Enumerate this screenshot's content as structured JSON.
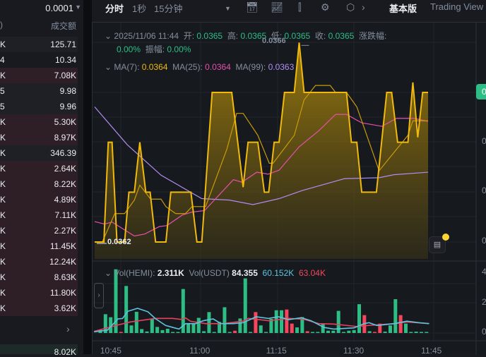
{
  "left_panel": {
    "tick_size": "0.0001",
    "col_left": ")",
    "col_right": "成交额",
    "rows": [
      {
        "l": "K",
        "r": "125.71",
        "t": "dark"
      },
      {
        "l": "4",
        "r": "10.34",
        "t": "none"
      },
      {
        "l": "K",
        "r": "7.08K",
        "t": "red"
      },
      {
        "l": "5",
        "r": "9.98",
        "t": "dark"
      },
      {
        "l": "5",
        "r": "9.96",
        "t": "dark"
      },
      {
        "l": "K",
        "r": "5.30K",
        "t": "red"
      },
      {
        "l": "K",
        "r": "8.97K",
        "t": "red"
      },
      {
        "l": "K",
        "r": "346.39",
        "t": "dark"
      },
      {
        "l": "K",
        "r": "2.64K",
        "t": "red"
      },
      {
        "l": "K",
        "r": "8.22K",
        "t": "red"
      },
      {
        "l": "K",
        "r": "4.89K",
        "t": "red"
      },
      {
        "l": "K",
        "r": "7.11K",
        "t": "red"
      },
      {
        "l": "K",
        "r": "2.27K",
        "t": "red"
      },
      {
        "l": "K",
        "r": "11.45K",
        "t": "red"
      },
      {
        "l": "K",
        "r": "12.24K",
        "t": "red"
      },
      {
        "l": "K",
        "r": "8.63K",
        "t": "red"
      },
      {
        "l": "K",
        "r": "11.80K",
        "t": "red"
      },
      {
        "l": "K",
        "r": "3.62K",
        "t": "red"
      }
    ],
    "more": "›",
    "last_value": "8.02K"
  },
  "toolbar": {
    "tab_time": "分时",
    "tab_1s": "1秒",
    "tab_15m": "15分钟",
    "basic": "基本版",
    "tradingview": "Trading View"
  },
  "legend": {
    "date": "2025/11/06 11:44",
    "open_l": "开:",
    "open": "0.0365",
    "high_l": "高:",
    "high": "0.0365",
    "low_l": "低:",
    "low": "0.0365",
    "close_l": "收:",
    "close": "0.0365",
    "chg_l": "涨跌幅:",
    "chg": "0.00%",
    "amp_l": "振幅:",
    "amp": "0.00%",
    "ma7_l": "MA(7):",
    "ma7": "0.0364",
    "ma25_l": "MA(25):",
    "ma25": "0.0364",
    "ma99_l": "MA(99):",
    "ma99": "0.0363",
    "vol_l": "Vol(HEMI):",
    "vol": "2.311K",
    "volu_l": "Vol(USDT)",
    "volu": "84.355",
    "vma1": "60.152K",
    "vma2": "63.04K"
  },
  "marks": {
    "high_label": "0.0366",
    "low_label": "0.0362"
  },
  "price_axis": {
    "badge": "0",
    "labels": [
      "0",
      "0",
      "0"
    ]
  },
  "vol_axis": [
    "4",
    "2",
    "0"
  ],
  "colors": {
    "price": "#f0b90b",
    "ma7": "#c99a0b",
    "ma25": "#e84fae",
    "ma99": "#b18cf2",
    "up": "#2ebd85",
    "down": "#f6465d",
    "vma1": "#5cc6e0",
    "vma2": "#e8415c"
  },
  "chart_data": [
    {
      "type": "area",
      "title": "分时",
      "xunit": "minutes from chart start",
      "ylim": [
        0.0362,
        0.0365
      ],
      "price": [
        [
          0,
          0.0362
        ],
        [
          1.7,
          0.0362
        ],
        [
          2.5,
          0.0364
        ],
        [
          3.2,
          0.0364
        ],
        [
          4.1,
          0.0362
        ],
        [
          5.5,
          0.0362
        ],
        [
          6.3,
          0.0363
        ],
        [
          7.3,
          0.0363
        ],
        [
          8.3,
          0.0364
        ],
        [
          9.4,
          0.0363
        ],
        [
          10.2,
          0.0363
        ],
        [
          11.2,
          0.0362
        ],
        [
          13.1,
          0.0362
        ],
        [
          14,
          0.0363
        ],
        [
          17.7,
          0.0363
        ],
        [
          18.8,
          0.0362
        ],
        [
          19.7,
          0.0362
        ],
        [
          21.6,
          0.0365
        ],
        [
          25.2,
          0.0365
        ],
        [
          27.3,
          0.03631
        ],
        [
          28.2,
          0.0364
        ],
        [
          30,
          0.0364
        ],
        [
          31.2,
          0.0363
        ],
        [
          32,
          0.0363
        ],
        [
          33,
          0.0364
        ],
        [
          33.9,
          0.0364
        ],
        [
          34.9,
          0.0365
        ],
        [
          36.7,
          0.0365
        ],
        [
          37.6,
          0.0366
        ],
        [
          38.5,
          0.0365
        ],
        [
          46.3,
          0.0365
        ],
        [
          47.2,
          0.0364
        ],
        [
          48.2,
          0.0364
        ],
        [
          49.1,
          0.0363
        ],
        [
          51.8,
          0.0363
        ],
        [
          53.7,
          0.0365
        ],
        [
          54.6,
          0.0365
        ],
        [
          55.7,
          0.0364
        ],
        [
          57.6,
          0.0364
        ],
        [
          58.5,
          0.03652
        ],
        [
          59.4,
          0.03641
        ],
        [
          60.3,
          0.0365
        ],
        [
          61.3,
          0.0365
        ]
      ],
      "ma7": [
        [
          0,
          0.0362
        ],
        [
          1.4,
          0.0362
        ],
        [
          3.7,
          0.036257
        ],
        [
          5.5,
          0.036257
        ],
        [
          7.3,
          0.036284
        ],
        [
          8.3,
          0.036314
        ],
        [
          10.3,
          0.036286
        ],
        [
          12.2,
          0.036286
        ],
        [
          13.1,
          0.036271
        ],
        [
          14.9,
          0.036257
        ],
        [
          16.7,
          0.036257
        ],
        [
          17.9,
          0.036271
        ],
        [
          20.4,
          0.036271
        ],
        [
          24.3,
          0.036386
        ],
        [
          26.1,
          0.036458
        ],
        [
          27.3,
          0.036458
        ],
        [
          30,
          0.036414
        ],
        [
          32.1,
          0.036358
        ],
        [
          32.8,
          0.036358
        ],
        [
          36.7,
          0.036414
        ],
        [
          38.5,
          0.036485
        ],
        [
          40.6,
          0.036514
        ],
        [
          43.3,
          0.036514
        ],
        [
          44.3,
          0.0365
        ],
        [
          46.3,
          0.0365
        ],
        [
          48.2,
          0.036471
        ],
        [
          52.3,
          0.036343
        ],
        [
          57.6,
          0.036414
        ],
        [
          58.5,
          0.036443
        ],
        [
          61.3,
          0.036443
        ]
      ],
      "ma25": [
        [
          0,
          0.036241
        ],
        [
          1.8,
          0.036236
        ],
        [
          3.2,
          0.03624
        ],
        [
          7.3,
          0.036212
        ],
        [
          9.2,
          0.036216
        ],
        [
          11.9,
          0.036231
        ],
        [
          13.3,
          0.036233
        ],
        [
          16.1,
          0.036254
        ],
        [
          17.9,
          0.03626
        ],
        [
          20.2,
          0.036263
        ],
        [
          25.5,
          0.036325
        ],
        [
          27.1,
          0.03632
        ],
        [
          29.8,
          0.03634
        ],
        [
          31.9,
          0.036336
        ],
        [
          33.9,
          0.036344
        ],
        [
          37.6,
          0.036391
        ],
        [
          41.3,
          0.036424
        ],
        [
          44.3,
          0.036456
        ],
        [
          46.3,
          0.036456
        ],
        [
          49.1,
          0.036439
        ],
        [
          52.8,
          0.036432
        ],
        [
          55.5,
          0.036448
        ],
        [
          58.7,
          0.036448
        ],
        [
          61.3,
          0.036442
        ]
      ],
      "ma99": [
        [
          0,
          0.036471
        ],
        [
          6,
          0.036395
        ],
        [
          12.2,
          0.036334
        ],
        [
          19.7,
          0.036287
        ],
        [
          24.8,
          0.036284
        ],
        [
          29.1,
          0.036275
        ],
        [
          33.9,
          0.036287
        ],
        [
          38.1,
          0.036303
        ],
        [
          45.9,
          0.036327
        ],
        [
          52.3,
          0.036329
        ],
        [
          55,
          0.036335
        ],
        [
          61.3,
          0.03634
        ]
      ],
      "x_ticks": [
        {
          "label": "10:45",
          "t": 3.1
        },
        {
          "label": "11:00",
          "t": 19.5
        },
        {
          "label": "11:15",
          "t": 33.6
        },
        {
          "label": "11:30",
          "t": 47.8
        },
        {
          "label": "11:45",
          "t": 62.1
        }
      ]
    },
    {
      "type": "bar",
      "title": "Vol(HEMI)",
      "yunit": "K",
      "ylim": [
        0,
        4.2
      ],
      "values": [
        0.2,
        1.24,
        1.04,
        4.2,
        0.06,
        3.1,
        0.5,
        1.4,
        0.26,
        0.1,
        0.93,
        0.4,
        0.19,
        0.28,
        0.06,
        0.06,
        2.9,
        0.65,
        0.62,
        1.0,
        0.12,
        1.38,
        0.06,
        0.73,
        1.7,
        0.06,
        0.15,
        0.96,
        3.6,
        0.06,
        1.38,
        0.5,
        0.06,
        0.93,
        1.5,
        1.5,
        1.55,
        0.62,
        0.37,
        1.05,
        0.12,
        0.06,
        0.06,
        0.62,
        0.15,
        0.15,
        1.46,
        0.06,
        0.15,
        0.19,
        1.9,
        1.18,
        0.12,
        0.06,
        0.62,
        0.09,
        0.5,
        2.23,
        1.18,
        0.62,
        0.06,
        0.09,
        0.06,
        0.06
      ],
      "dir": "ggggrgggggggggggggggggggggrgggrgggggrrggrggggggggggrgrrgggrggggg",
      "ma1": [
        [
          -1.2,
          0.08
        ],
        [
          1.4,
          0.19
        ],
        [
          3.4,
          0.93
        ],
        [
          4.3,
          0.96
        ],
        [
          5.3,
          1.43
        ],
        [
          7.2,
          1.63
        ],
        [
          9.2,
          1.4
        ],
        [
          10.6,
          0.96
        ],
        [
          12.6,
          0.5
        ],
        [
          14,
          0.37
        ],
        [
          15.2,
          0.26
        ],
        [
          16.5,
          0.62
        ],
        [
          18.4,
          0.62
        ],
        [
          19.9,
          0.81
        ],
        [
          21.8,
          0.93
        ],
        [
          23.3,
          0.62
        ],
        [
          25.7,
          0.62
        ],
        [
          27.6,
          0.68
        ],
        [
          30.1,
          1.07
        ],
        [
          32.5,
          0.96
        ],
        [
          34.4,
          1.07
        ],
        [
          36.4,
          0.88
        ],
        [
          38.8,
          1.01
        ],
        [
          40.7,
          0.81
        ],
        [
          43.2,
          0.37
        ],
        [
          45.1,
          0.26
        ],
        [
          49,
          0.34
        ],
        [
          51,
          0.62
        ],
        [
          51.9,
          0.68
        ],
        [
          53.4,
          0.5
        ],
        [
          56.8,
          0.62
        ],
        [
          59.2,
          0.78
        ],
        [
          61.6,
          0.68
        ],
        [
          63.5,
          0.62
        ]
      ],
      "ma2": [
        [
          -1.2,
          0.11
        ],
        [
          3.4,
          0.53
        ],
        [
          5.8,
          0.73
        ],
        [
          10.6,
          0.96
        ],
        [
          14,
          0.96
        ],
        [
          15.5,
          0.9
        ],
        [
          16.5,
          0.99
        ],
        [
          17.4,
          0.78
        ],
        [
          20.3,
          0.62
        ],
        [
          23.7,
          0.62
        ],
        [
          27.6,
          0.78
        ],
        [
          28.6,
          0.96
        ],
        [
          32.5,
          0.81
        ],
        [
          36.4,
          0.96
        ],
        [
          39.3,
          0.91
        ],
        [
          42.2,
          0.62
        ],
        [
          45.1,
          0.59
        ],
        [
          49.5,
          0.43
        ],
        [
          51.9,
          0.5
        ],
        [
          56.8,
          0.62
        ],
        [
          59.2,
          0.73
        ],
        [
          63.5,
          0.62
        ]
      ]
    }
  ]
}
